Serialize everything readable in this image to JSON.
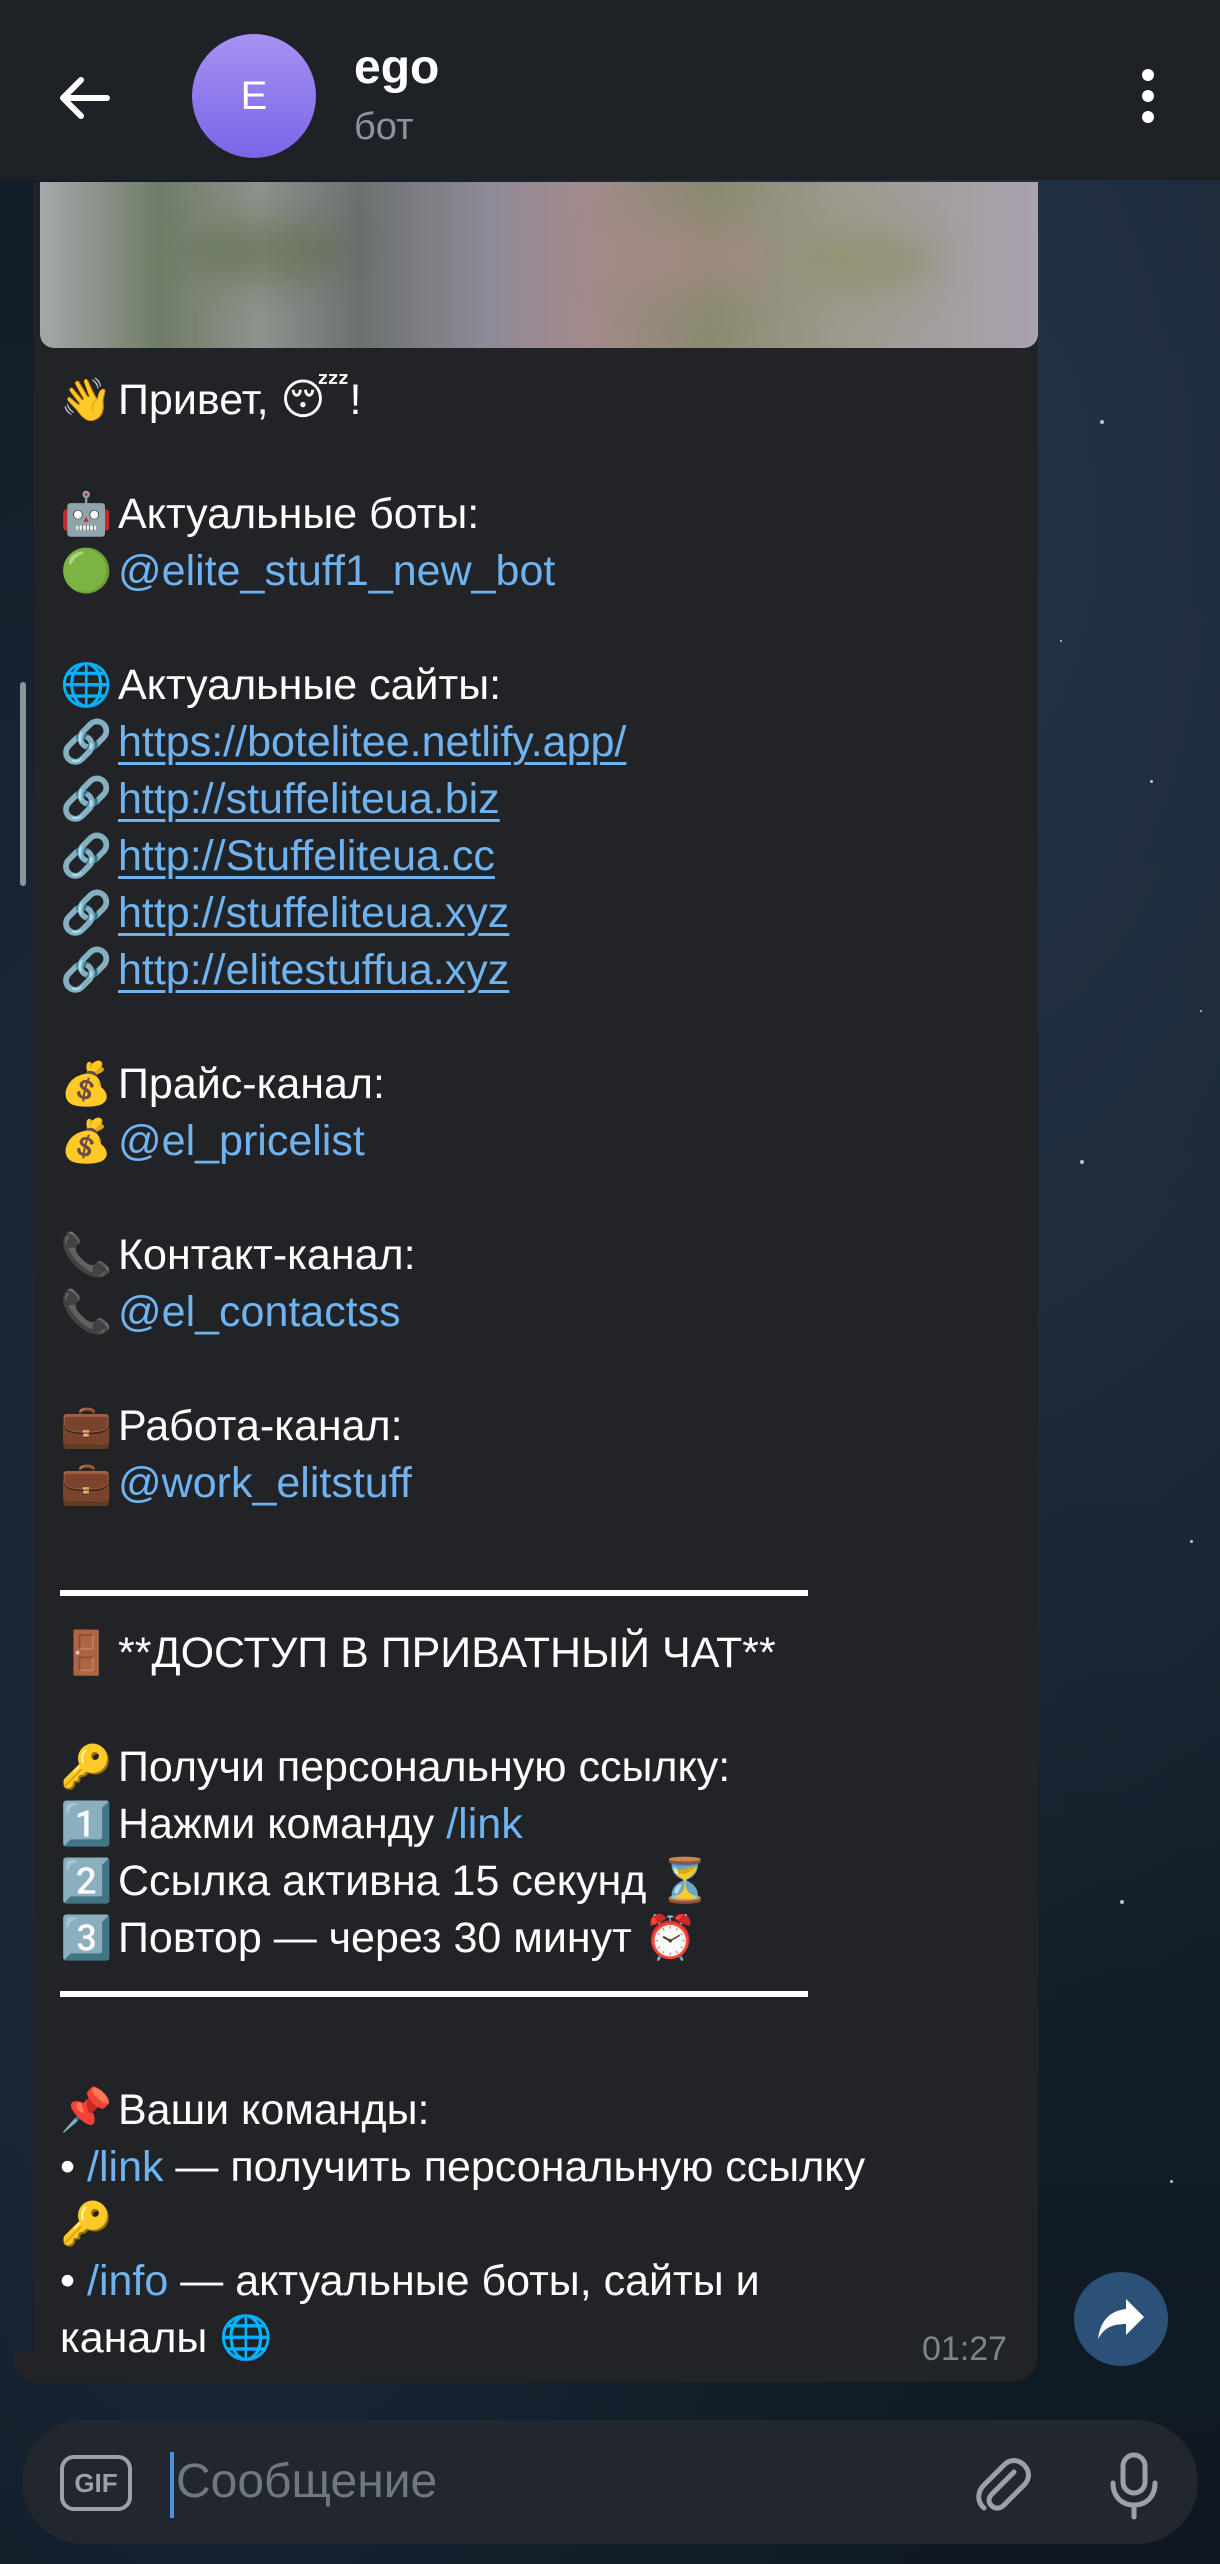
{
  "header": {
    "avatar_letter": "E",
    "title": "ego",
    "subtitle": "бот"
  },
  "message": {
    "greeting": "Привет,",
    "greeting_end": "!",
    "bots_label": "Актуальные боты:",
    "bot_handle": "@elite_stuff1_new_bot",
    "sites_label": "Актуальные сайты:",
    "sites": [
      "https://botelitee.netlify.app/",
      "http://stuffeliteua.biz",
      "http://Stuffeliteua.cc",
      "http://stuffeliteua.xyz",
      "http://elitestuffua.xyz"
    ],
    "price_label": "Прайс-канал:",
    "price_handle": "@el_pricelist",
    "contact_label": "Контакт-канал:",
    "contact_handle": "@el_contactss",
    "work_label": "Работа-канал:",
    "work_handle": "@work_elitstuff",
    "private_title": "**ДОСТУП В ПРИВАТНЫЙ ЧАТ**",
    "get_link": "Получи персональную ссылку:",
    "step1": "Нажми команду ",
    "step1_cmd": "/link",
    "step2": "Ссылка активна 15 секунд",
    "step3": "Повтор — через 30 минут",
    "commands_label": "Ваши команды:",
    "cmd1_bullet": "• ",
    "cmd1": "/link",
    "cmd1_desc": " — получить персональную ссылку",
    "cmd2_bullet": "• ",
    "cmd2": "/info",
    "cmd2_desc": " — актуальные боты, сайты и",
    "cmd2_desc2": "каналы",
    "time": "01:27"
  },
  "input": {
    "gif_label": "GIF",
    "placeholder": "Сообщение"
  },
  "icons": {
    "back": "arrow-left-icon",
    "menu": "more-vertical-icon",
    "forward": "share-arrow-icon",
    "attach": "paperclip-icon",
    "mic": "microphone-icon"
  },
  "colors": {
    "header_bg": "#1e2227",
    "bubble_bg": "#212327",
    "link": "#6fb3f0",
    "avatar": "#8b76ec",
    "forward_button": "#2b5178"
  }
}
